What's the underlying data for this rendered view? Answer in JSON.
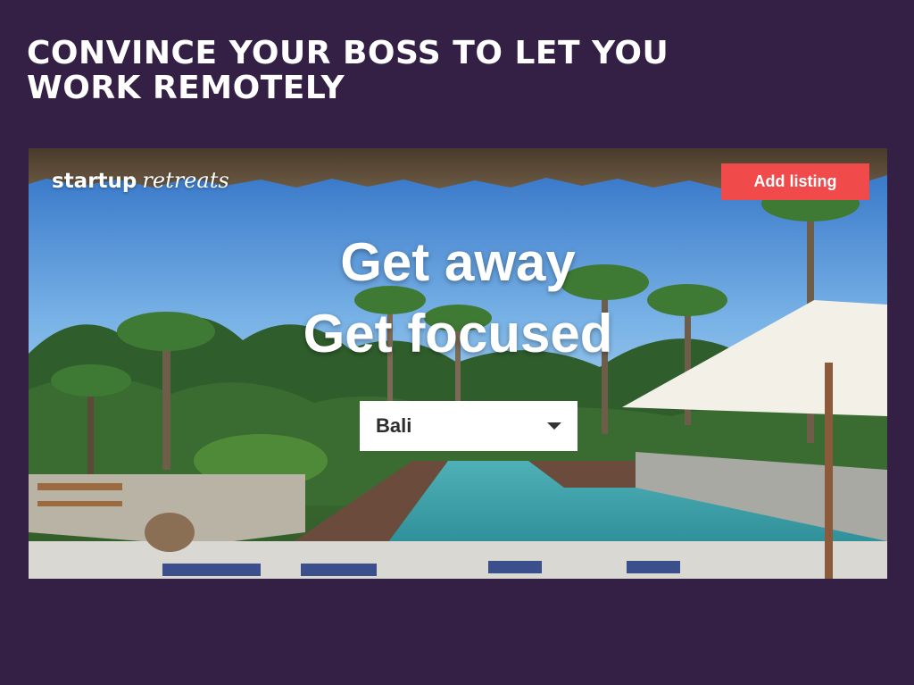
{
  "slide": {
    "title_line1": "CONVINCE YOUR BOSS TO LET YOU",
    "title_line2": "WORK REMOTELY"
  },
  "site": {
    "logo_part1": "startup",
    "logo_part2": "retreats",
    "add_listing_label": "Add listing",
    "hero_line1": "Get away",
    "hero_line2": "Get focused",
    "location_select": {
      "selected": "Bali"
    }
  },
  "colors": {
    "slide_background": "#341f45",
    "accent_button": "#f04a4a",
    "text_light": "#ffffff"
  },
  "icons": {
    "dropdown": "chevron-down-icon"
  }
}
